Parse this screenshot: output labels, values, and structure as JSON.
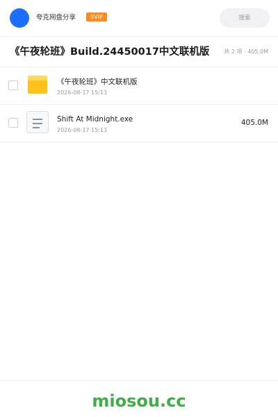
{
  "header": {
    "app_name": "夸克网盘分享",
    "badge": "SVIP",
    "search_placeholder": "搜索"
  },
  "folder": {
    "title": "《午夜轮班》Build.24450017中文联机版",
    "summary": "共 2 项 · 405.0M"
  },
  "items": [
    {
      "name": "《午夜轮班》中文联机版",
      "date": "2026-08-17 15:13",
      "size": "",
      "icon": "folder-icon"
    },
    {
      "name": "Shift At Midnight.exe",
      "date": "2026-08-17 15:13",
      "size": "405.0M",
      "icon": "file-icon"
    }
  ],
  "footer": {
    "watermark": "miosou.cc"
  },
  "colors": {
    "accent": "#1e6fff",
    "badge": "#ff8a1f",
    "watermark": "#3fae49"
  }
}
